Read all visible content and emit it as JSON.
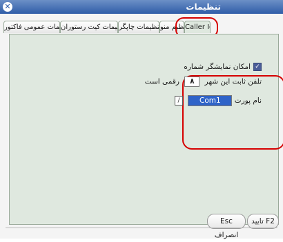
{
  "window": {
    "title": "تنظیمات",
    "close_glyph": "✕"
  },
  "tabs": [
    {
      "label": "Caller Id",
      "active": true
    },
    {
      "label": "تنظیم منو",
      "active": false
    },
    {
      "label": "تنظیمات چاپگر",
      "active": false
    },
    {
      "label": "تنظیمات کیت رستوران",
      "active": false
    },
    {
      "label": "تنظیمات عمومی فاکتور",
      "active": false
    }
  ],
  "callerid": {
    "show_number_label": "امکان نمایشگر شماره",
    "show_number_checked": true,
    "check_glyph": "✓",
    "city_phone_prefix": "تلفن ثابت این شهر",
    "city_phone_value": "۸",
    "city_phone_suffix": "رقمی است",
    "port_label": "نام پورت",
    "port_value": "Com1",
    "picker_glyph": "/"
  },
  "buttons": {
    "confirm": "F2 تایید",
    "cancel": "Esc انصراف"
  },
  "colors": {
    "titlebar": "#2f5da8",
    "pane": "#dfe8df",
    "highlight": "#d60000",
    "selection": "#2f63c8"
  }
}
